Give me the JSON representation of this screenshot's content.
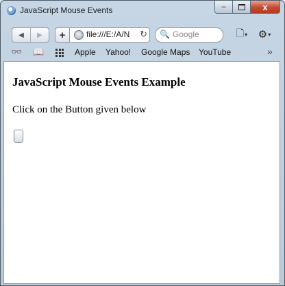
{
  "window": {
    "title": "JavaScript Mouse Events",
    "controls": {
      "minimize": "–",
      "close": "x"
    }
  },
  "toolbar": {
    "back_glyph": "◀",
    "forward_glyph": "▶",
    "add_glyph": "+",
    "url": "file:///E:/A/N",
    "reload_glyph": "↻",
    "search_placeholder": "Google",
    "search_glyph": "🔍",
    "page_menu_glyph": "🗋",
    "settings_glyph": "⚙",
    "dropdown_glyph": "▾"
  },
  "bookmarks": {
    "reading_list_glyph": "👓",
    "bookmarks_glyph": "📖",
    "items": [
      "Apple",
      "Yahoo!",
      "Google Maps",
      "YouTube"
    ],
    "more_glyph": "»"
  },
  "page": {
    "heading": "JavaScript Mouse Events Example",
    "instruction": "Click on the Button given below",
    "button_label": ""
  },
  "colors": {
    "chrome": "#c7d6e4",
    "close_button": "#c44a31",
    "page_background": "#ffffff"
  }
}
